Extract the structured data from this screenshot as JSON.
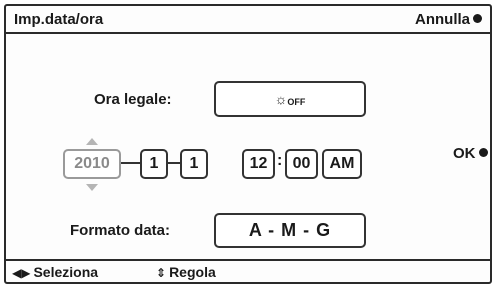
{
  "header": {
    "title": "Imp.data/ora",
    "cancel_label": "Annulla"
  },
  "dst": {
    "label": "Ora legale:",
    "icon": "sun-dst-icon",
    "value_suffix": "OFF"
  },
  "datetime": {
    "year": "2010",
    "month": "1",
    "day": "1",
    "hour": "12",
    "minute": "00",
    "ampm": "AM",
    "time_separator": ":"
  },
  "ok_label": "OK",
  "date_format": {
    "label": "Formato data:",
    "value": "A - M - G"
  },
  "footer": {
    "select_label": "Seleziona",
    "adjust_label": "Regola"
  }
}
